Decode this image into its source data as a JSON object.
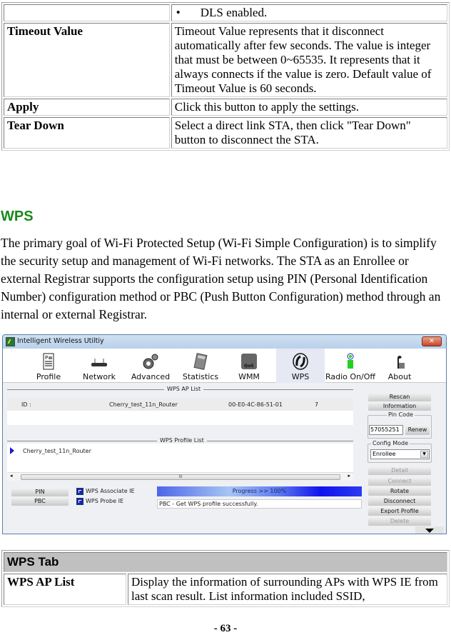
{
  "top_table": {
    "rows": [
      {
        "label": "",
        "bullet": "•",
        "desc": "DLS enabled."
      },
      {
        "label": "Timeout Value",
        "desc": "Timeout Value represents that it disconnect automatically after few seconds. The value is integer that must be between 0~65535. It represents that it always connects if the value is zero. Default value of Timeout Value is 60 seconds."
      },
      {
        "label": "Apply",
        "desc": "Click this button to apply the settings."
      },
      {
        "label": "Tear Down",
        "desc": "Select a direct link STA, then click \"Tear Down\" button to disconnect the STA."
      }
    ]
  },
  "section": {
    "heading": "WPS",
    "heading_color": "#1a8a1a",
    "paragraph": "The primary goal of Wi-Fi Protected Setup (Wi-Fi Simple Configuration) is to simplify the security setup and management of Wi-Fi networks. The STA as an Enrollee or external Registrar supports the configuration setup using PIN (Personal Identification Number) configuration method or PBC (Push Button Configuration) method through an internal or external Registrar."
  },
  "app": {
    "title": "Intelligent Wireless Utiltiy",
    "close_glyph": "✕",
    "toolbar": [
      {
        "label": "Profile",
        "icon": "profile-icon"
      },
      {
        "label": "Network",
        "icon": "network-icon"
      },
      {
        "label": "Advanced",
        "icon": "advanced-icon"
      },
      {
        "label": "Statistics",
        "icon": "statistics-icon"
      },
      {
        "label": "WMM",
        "icon": "wmm-qos-icon"
      },
      {
        "label": "WPS",
        "icon": "wps-icon",
        "active": true
      },
      {
        "label": "Radio On/Off",
        "icon": "radio-icon"
      },
      {
        "label": "About",
        "icon": "about-icon"
      }
    ],
    "ap_list": {
      "title": "WPS AP List",
      "row": {
        "id_label": "ID :",
        "ssid": "Cherry_test_11n_Router",
        "mac": "00-E0-4C-86-51-01",
        "channel": "7"
      }
    },
    "profile_list": {
      "title": "WPS Profile List",
      "items": [
        "Cherry_test_11n_Router"
      ]
    },
    "scroll_glyph": "III",
    "buttons": {
      "pin": "PIN",
      "pbc": "PBC",
      "rescan": "Rescan",
      "information": "Information",
      "renew": "Renew",
      "detail": "Detail",
      "connect": "Connect",
      "rotate": "Rotate",
      "disconnect": "Disconnect",
      "export_profile": "Export Profile",
      "delete": "Delete"
    },
    "checkboxes": [
      {
        "label": "WPS Associate IE",
        "checked": true
      },
      {
        "label": "WPS Probe IE",
        "checked": true
      }
    ],
    "progress": {
      "text": "Progress >> 100%",
      "value": 100
    },
    "status": "PBC - Get WPS profile successfully.",
    "pin_code": {
      "legend": "Pin Code",
      "value": "57055251"
    },
    "config_mode": {
      "legend": "Config Mode",
      "value": "Enrollee"
    }
  },
  "wps_tab_table": {
    "header": "WPS Tab",
    "rows": [
      {
        "label": "WPS AP List",
        "desc": "Display the information of surrounding APs with WPS IE from last scan result. List information included SSID,"
      }
    ]
  },
  "page_number": "- 63 -"
}
